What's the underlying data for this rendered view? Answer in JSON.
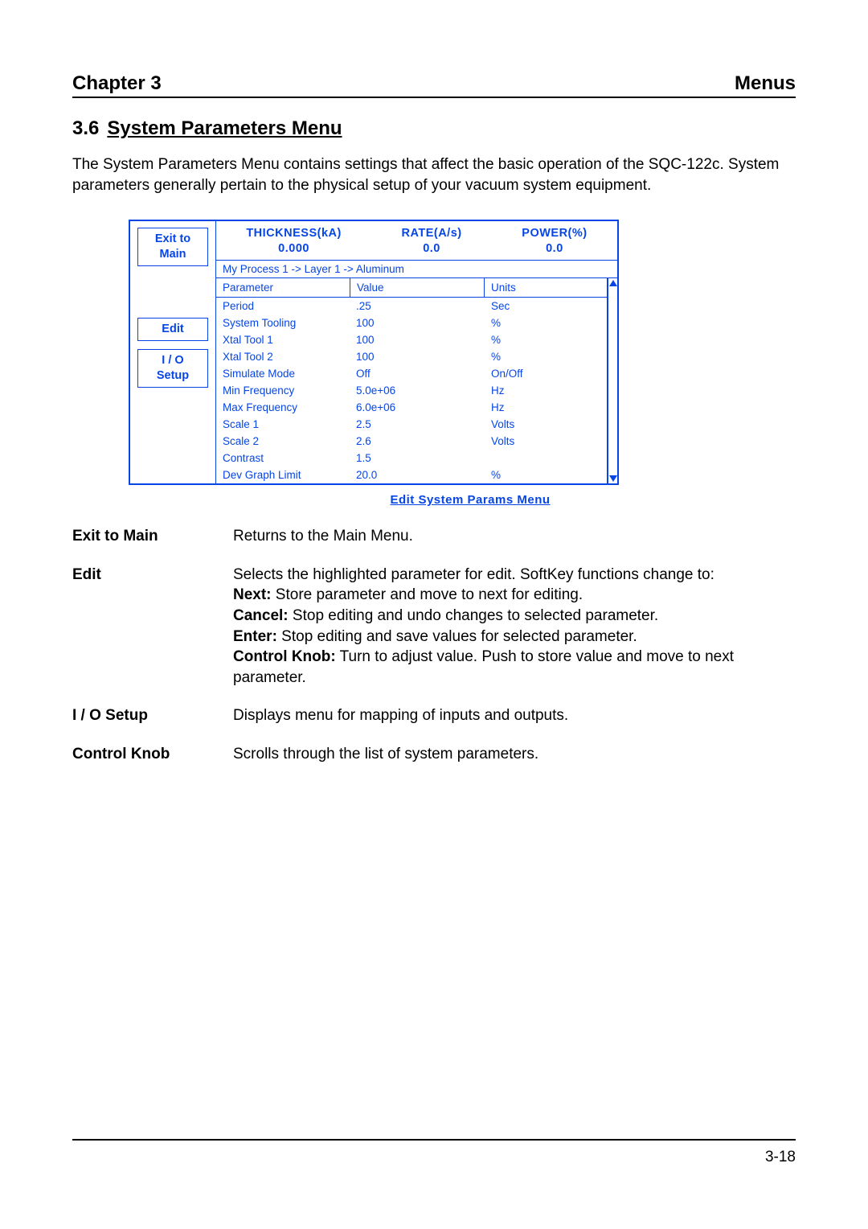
{
  "header": {
    "left": "Chapter 3",
    "right": "Menus"
  },
  "section": {
    "number": "3.6",
    "title": "System Parameters Menu"
  },
  "intro": "The System Parameters Menu contains settings that affect the basic operation of the SQC-122c.  System parameters generally pertain to the physical setup of your vacuum system equipment.",
  "screen": {
    "softkeys": {
      "exit_line1": "Exit to",
      "exit_line2": "Main",
      "edit": "Edit",
      "io_line1": "I / O",
      "io_line2": "Setup"
    },
    "readouts": {
      "thickness_label": "THICKNESS(kA)",
      "thickness_value": "0.000",
      "rate_label": "RATE(A/s)",
      "rate_value": "0.0",
      "power_label": "POWER(%)",
      "power_value": "0.0"
    },
    "breadcrumb": "My Process 1 -> Layer 1 -> Aluminum",
    "columns": {
      "c1": "Parameter",
      "c2": "Value",
      "c3": "Units"
    },
    "rows": [
      {
        "p": "Period",
        "v": ".25",
        "u": "Sec"
      },
      {
        "p": "System Tooling",
        "v": "100",
        "u": "%"
      },
      {
        "p": "Xtal Tool 1",
        "v": "100",
        "u": "%"
      },
      {
        "p": "Xtal Tool 2",
        "v": "100",
        "u": "%"
      },
      {
        "p": "Simulate Mode",
        "v": "Off",
        "u": "On/Off"
      },
      {
        "p": "Min Frequency",
        "v": "5.0e+06",
        "u": "Hz"
      },
      {
        "p": "Max Frequency",
        "v": "6.0e+06",
        "u": "Hz"
      },
      {
        "p": "Scale 1",
        "v": "2.5",
        "u": "Volts"
      },
      {
        "p": "Scale 2",
        "v": "2.6",
        "u": "Volts"
      },
      {
        "p": "Contrast",
        "v": "1.5",
        "u": ""
      },
      {
        "p": "Dev Graph Limit",
        "v": "20.0",
        "u": "%"
      }
    ],
    "caption": "Edit System Params Menu"
  },
  "descriptions": {
    "exit": {
      "term": "Exit to Main",
      "def": "Returns to the Main Menu."
    },
    "edit": {
      "term": "Edit",
      "lead": "Selects the highlighted parameter for edit.  SoftKey functions change to:",
      "next_b": "Next:",
      "next_t": " Store parameter and move to next for editing.",
      "cancel_b": "Cancel:",
      "cancel_t": " Stop editing and undo changes to selected parameter.",
      "enter_b": "Enter:",
      "enter_t": " Stop editing and save values for selected parameter.",
      "knob_b": "Control Knob:",
      "knob_t": " Turn to adjust value.  Push to store value and move to next parameter."
    },
    "io": {
      "term": "I / O Setup",
      "def": "Displays menu for mapping of inputs and outputs."
    },
    "knob": {
      "term": "Control Knob",
      "def": "Scrolls through the list of system parameters."
    }
  },
  "page_number": "3-18"
}
